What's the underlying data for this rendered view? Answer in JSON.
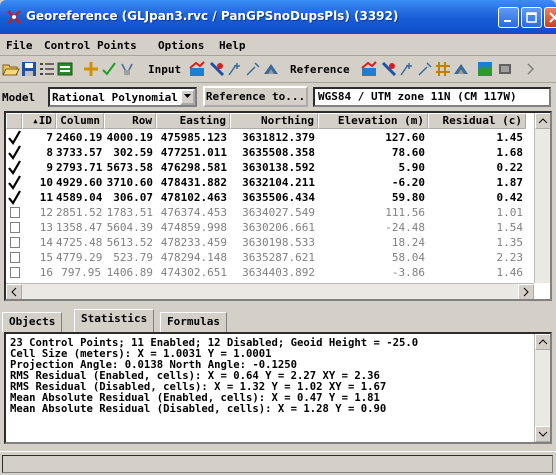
{
  "window": {
    "title": "Georeference (GLJpan3.rvc / PanGPSnoDupsPls) (3392)"
  },
  "menu": [
    "File",
    "Control Points",
    "Options",
    "Help"
  ],
  "toolbar": {
    "input_label": "Input",
    "reference_label": "Reference"
  },
  "modelbar": {
    "model_label": "Model",
    "model_value": "Rational Polynomial",
    "reference_button": "Reference to...",
    "reference_value": "WGS84 / UTM zone 11N (CM 117W)"
  },
  "table": {
    "headers": [
      "▴ID",
      "Column",
      "Row",
      "Easting",
      "Northing",
      "Elevation (m)",
      "Residual (c)"
    ],
    "rows": [
      {
        "checked": true,
        "id": "7",
        "column": "2460.19",
        "row": "4000.19",
        "easting": "475985.123",
        "northing": "3631812.379",
        "elevation": "127.60",
        "residual": "1.45"
      },
      {
        "checked": true,
        "id": "8",
        "column": "3733.57",
        "row": "302.59",
        "easting": "477251.011",
        "northing": "3635508.358",
        "elevation": "78.60",
        "residual": "1.68"
      },
      {
        "checked": true,
        "id": "9",
        "column": "2793.71",
        "row": "5673.58",
        "easting": "476298.581",
        "northing": "3630138.592",
        "elevation": "5.90",
        "residual": "0.22"
      },
      {
        "checked": true,
        "id": "10",
        "column": "4929.60",
        "row": "3710.60",
        "easting": "478431.882",
        "northing": "3632104.211",
        "elevation": "-6.20",
        "residual": "1.87"
      },
      {
        "checked": true,
        "id": "11",
        "column": "4589.04",
        "row": "306.07",
        "easting": "478102.463",
        "northing": "3635506.434",
        "elevation": "59.80",
        "residual": "0.42"
      },
      {
        "checked": false,
        "id": "12",
        "column": "2851.52",
        "row": "1783.51",
        "easting": "476374.453",
        "northing": "3634027.549",
        "elevation": "111.56",
        "residual": "1.01"
      },
      {
        "checked": false,
        "id": "13",
        "column": "1358.47",
        "row": "5604.39",
        "easting": "474859.998",
        "northing": "3630206.661",
        "elevation": "-24.48",
        "residual": "1.54"
      },
      {
        "checked": false,
        "id": "14",
        "column": "4725.48",
        "row": "5613.52",
        "easting": "478233.459",
        "northing": "3630198.533",
        "elevation": "18.24",
        "residual": "1.35"
      },
      {
        "checked": false,
        "id": "15",
        "column": "4779.29",
        "row": "523.79",
        "easting": "478294.148",
        "northing": "3635287.621",
        "elevation": "58.04",
        "residual": "2.23"
      },
      {
        "checked": false,
        "id": "16",
        "column": "797.95",
        "row": "1406.89",
        "easting": "474302.651",
        "northing": "3634403.892",
        "elevation": "-3.86",
        "residual": "1.46"
      }
    ]
  },
  "tabs": [
    "Objects",
    "Statistics",
    "Formulas"
  ],
  "active_tab": "Statistics",
  "stats": [
    "23 Control Points; 11 Enabled; 12 Disabled; Geoid Height = -25.0",
    "Cell Size (meters): X = 1.0031 Y = 1.0001",
    "Projection Angle: 0.0138 North Angle: -0.1250",
    "RMS Residual (Enabled, cells): X = 0.64 Y = 2.27 XY = 2.36",
    "RMS Residual (Disabled, cells): X = 1.32 Y = 1.02 XY = 1.67",
    "Mean Absolute Residual (Enabled, cells): X = 0.47 Y = 1.81",
    "Mean Absolute Residual (Disabled, cells): X = 1.28 Y = 0.90"
  ],
  "colors": {
    "titlebar": "#1a5fd8",
    "enabled_text": "#000000",
    "disabled_text": "#808080",
    "window_bg": "#d4d0c8"
  }
}
